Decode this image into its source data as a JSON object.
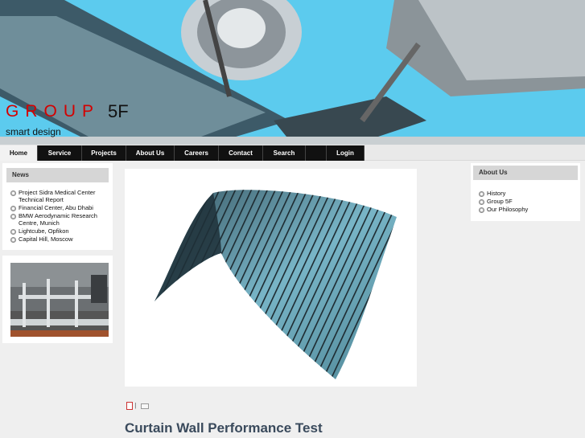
{
  "brand": {
    "name": "GROUP",
    "number": "5F",
    "tagline": "smart design"
  },
  "nav": {
    "items": [
      "Home",
      "Service",
      "Projects",
      "About Us",
      "Careers",
      "Contact",
      "Search",
      "",
      "Login"
    ],
    "active": "Home"
  },
  "news": {
    "title": "News",
    "items": [
      "Project Sidra Medical Center Technical Report",
      "Financial Center, Abu Dhabi",
      "BMW Aerodynamic Research Centre, Munich",
      "Lightcube, Opfikon",
      "Capital Hill, Moscow"
    ]
  },
  "about": {
    "title": "About Us",
    "items": [
      "History",
      "Group 5F",
      "Our Philosophy"
    ]
  },
  "article": {
    "separator": "|",
    "title": "Curtain Wall Performance Test"
  }
}
